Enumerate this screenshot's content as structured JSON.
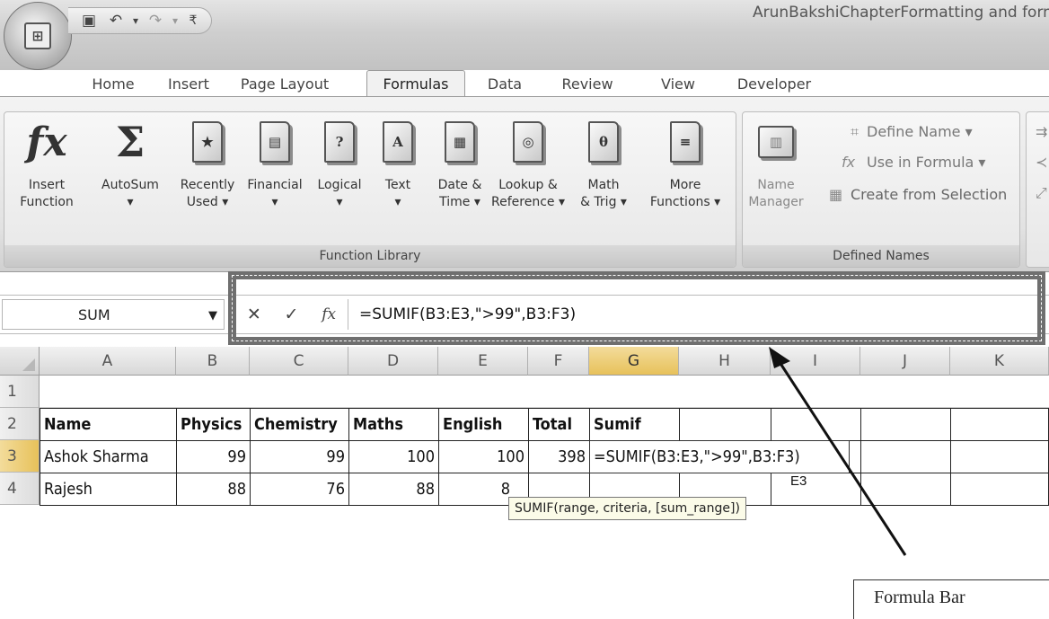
{
  "window": {
    "title": "ArunBakshiChapterFormatting and form"
  },
  "office_button": {
    "label": "Office"
  },
  "tabs": [
    "Home",
    "Insert",
    "Page Layout",
    "Formulas",
    "Data",
    "Review",
    "View",
    "Developer"
  ],
  "active_tab": "Formulas",
  "ribbon": {
    "function_library": {
      "label": "Function Library",
      "buttons": {
        "insert_function": "Insert\nFunction",
        "autosum": "AutoSum\n▾",
        "recently_used": "Recently\nUsed ▾",
        "financial": "Financial\n▾",
        "logical": "Logical\n▾",
        "text": "Text\n▾",
        "date_time": "Date &\nTime ▾",
        "lookup_reference": "Lookup &\nReference ▾",
        "math_trig": "Math\n& Trig ▾",
        "more_functions": "More\nFunctions ▾"
      }
    },
    "defined_names": {
      "label": "Defined Names",
      "name_manager": "Name\nManager",
      "define_name": "Define Name ▾",
      "use_in_formula": "Use in Formula ▾",
      "create_from_selection": "Create from Selection"
    }
  },
  "formula_bar": {
    "name_box": "SUM",
    "cancel": "✕",
    "enter": "✓",
    "fx": "fx",
    "formula": "=SUMIF(B3:E3,\">99\",B3:F3)"
  },
  "grid": {
    "columns": [
      "A",
      "B",
      "C",
      "D",
      "E",
      "F",
      "G",
      "H",
      "I",
      "J",
      "K"
    ],
    "rows": [
      "1",
      "2",
      "3",
      "4"
    ],
    "header_row": [
      "Name",
      "Physics",
      "Chemistry",
      "Maths",
      "English",
      "Total",
      "Sumif"
    ],
    "row3": {
      "name": "Ashok Sharma",
      "values": [
        "99",
        "99",
        "100",
        "100",
        "398"
      ],
      "formula_cell": "=SUMIF(B3:E3,\">99\",B3:F3)"
    },
    "row4": {
      "name": "Rajesh",
      "values": [
        "88",
        "76",
        "88",
        "8"
      ]
    },
    "tooltip": "SUMIF(range, criteria, [sum_range])",
    "ref_overlay": "E3"
  },
  "annotation": {
    "label": "Formula Bar"
  },
  "colors": {
    "selected_header": "#e7c15a",
    "highlight_frame": "#6f6f6f"
  }
}
